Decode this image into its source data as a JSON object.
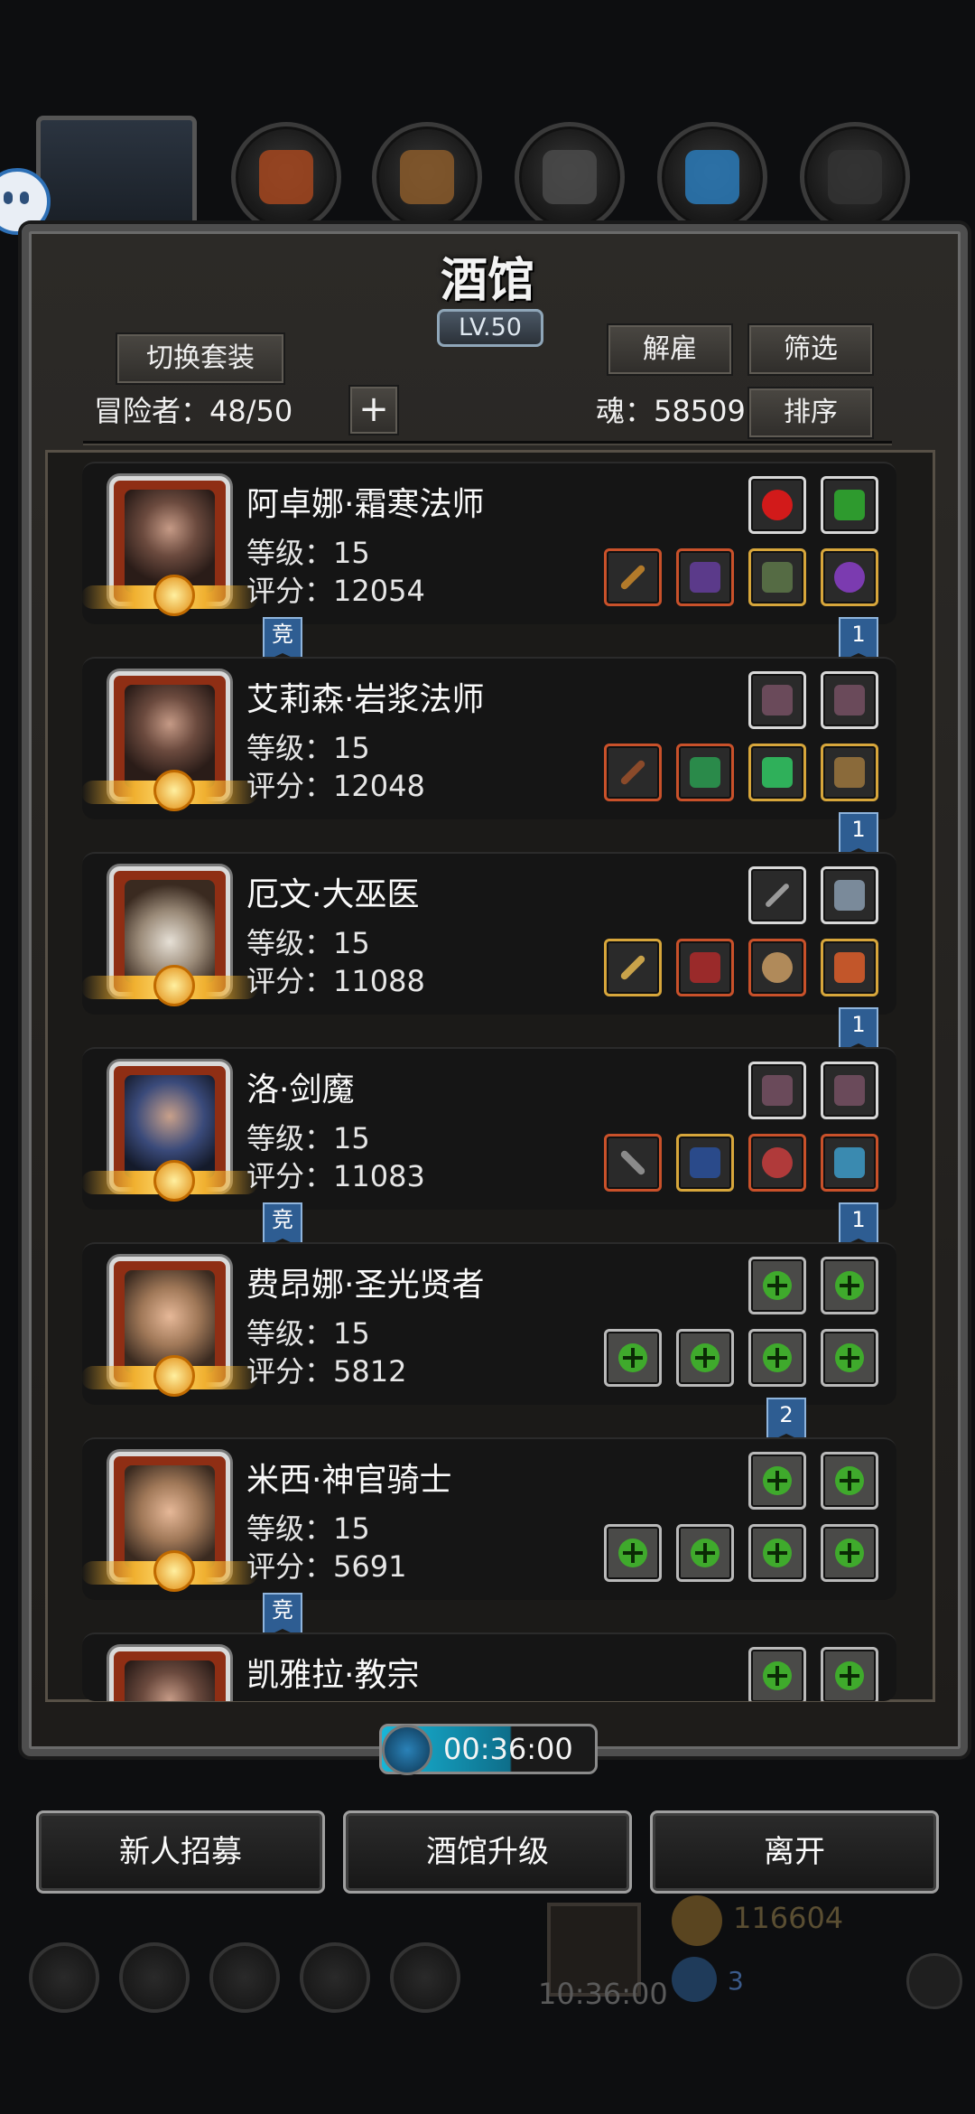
{
  "header": {
    "title": "酒馆",
    "level": "LV.50"
  },
  "toolbar": {
    "switch_outfit": "切换套装",
    "dismiss": "解雇",
    "filter": "筛选",
    "sort": "排序",
    "adventurers_label": "冒险者：48/50",
    "soul_label": "魂：58509",
    "add_symbol": "+"
  },
  "heroes": [
    {
      "name": "阿卓娜·霜寒法师",
      "level": "等级：15",
      "score": "评分：12054",
      "tag": "竞",
      "rank": "1"
    },
    {
      "name": "艾莉森·岩浆法师",
      "level": "等级：15",
      "score": "评分：12048",
      "tag": "",
      "rank": "1"
    },
    {
      "name": "厄文·大巫医",
      "level": "等级：15",
      "score": "评分：11088",
      "tag": "",
      "rank": "1"
    },
    {
      "name": "洛·剑魔",
      "level": "等级：15",
      "score": "评分：11083",
      "tag": "竞",
      "rank": "1"
    },
    {
      "name": "费昂娜·圣光贤者",
      "level": "等级：15",
      "score": "评分：5812",
      "tag": "",
      "rank": "2"
    },
    {
      "name": "米西·神官骑士",
      "level": "等级：15",
      "score": "评分：5691",
      "tag": "竞",
      "rank": ""
    },
    {
      "name": "凯雅拉·教宗",
      "level": "",
      "score": "",
      "tag": "",
      "rank": ""
    }
  ],
  "timer": "00:36:00",
  "buttons": {
    "recruit": "新人招募",
    "upgrade": "酒馆升级",
    "leave": "离开"
  },
  "background_hud": {
    "gold": "116604",
    "gems": "3",
    "gift_timer": "10:36:00"
  },
  "colors": {
    "frame": "#4e4e4e",
    "tag_blue": "#2e5d92",
    "equip_gold": "#d7a63b",
    "equip_red": "#c9512a",
    "empty_plus": "#3faa2c"
  }
}
